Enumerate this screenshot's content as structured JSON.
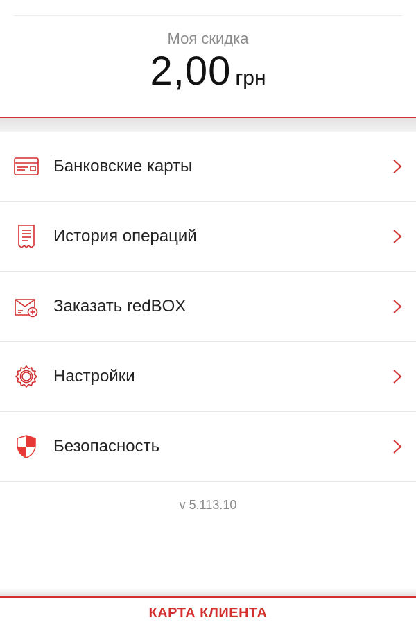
{
  "discount": {
    "label": "Моя скидка",
    "amount": "2,00",
    "currency": "грн"
  },
  "menu": {
    "items": [
      {
        "label": "Банковские карты",
        "icon": "bank-card-icon"
      },
      {
        "label": "История операций",
        "icon": "receipt-icon"
      },
      {
        "label": "Заказать redBOX",
        "icon": "redbox-order-icon"
      },
      {
        "label": "Настройки",
        "icon": "gear-icon"
      },
      {
        "label": "Безопасность",
        "icon": "shield-icon"
      }
    ]
  },
  "version": "v 5.113.10",
  "bottom_tab": {
    "label": "КАРТА КЛИЕНТА"
  },
  "colors": {
    "accent": "#d32f2f",
    "text": "#222222",
    "muted": "#8a8a8a",
    "divider": "#e6e6e6"
  }
}
